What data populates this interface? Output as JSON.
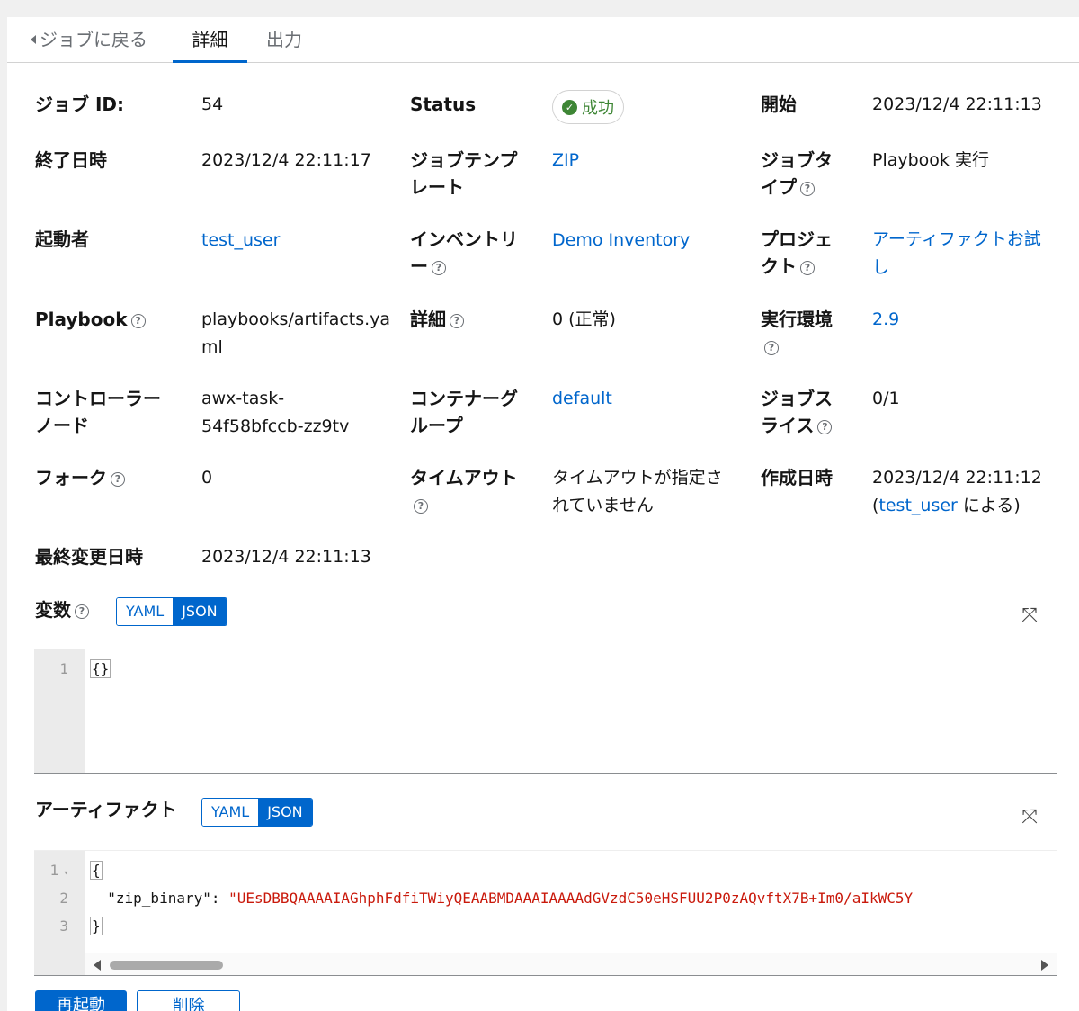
{
  "tabs": {
    "back": "ジョブに戻る",
    "detail": "詳細",
    "output": "出力"
  },
  "details": {
    "job_id": {
      "label": "ジョブ ID:",
      "value": "54"
    },
    "status": {
      "label": "Status",
      "value": "成功"
    },
    "started": {
      "label": "開始",
      "value": "2023/12/4 22:11:13"
    },
    "finished": {
      "label": "終了日時",
      "value": "2023/12/4 22:11:17"
    },
    "job_template": {
      "label_1": "ジョブテンプ",
      "label_2": "レート",
      "value": "ZIP"
    },
    "job_type": {
      "label_1": "ジョブタ",
      "label_2": "イプ",
      "value": "Playbook 実行"
    },
    "launched_by": {
      "label": "起動者",
      "value": "test_user"
    },
    "inventory": {
      "label_1": "インベントリ",
      "label_2": "ー",
      "value": "Demo Inventory"
    },
    "project": {
      "label_1": "プロジェ",
      "label_2": "クト",
      "value_1": "アーティファクトお試",
      "value_2": "し"
    },
    "playbook": {
      "label": "Playbook",
      "value_1": "playbooks/artifacts.ya",
      "value_2": "ml"
    },
    "verbosity": {
      "label": "詳細",
      "value": "0 (正常)"
    },
    "execution_env": {
      "label": "実行環境",
      "value": "2.9"
    },
    "controller_node": {
      "label_1": "コントローラー",
      "label_2": "ノード",
      "value_1": "awx-task-",
      "value_2": "54f58bfccb-zz9tv"
    },
    "container_group": {
      "label_1": "コンテナーグ",
      "label_2": "ループ",
      "value": "default"
    },
    "job_slice": {
      "label_1": "ジョブス",
      "label_2": "ライス",
      "value": "0/1"
    },
    "forks": {
      "label": "フォーク",
      "value": "0"
    },
    "timeout": {
      "label": "タイムアウト",
      "value_1": "タイムアウトが指定さ",
      "value_2": "れていません"
    },
    "created": {
      "label": "作成日時",
      "value": "2023/12/4 22:11:12",
      "by_prefix": "(",
      "by_user": "test_user",
      "by_suffix": " による)"
    },
    "modified": {
      "label": "最終変更日時",
      "value": "2023/12/4 22:11:13"
    }
  },
  "variables": {
    "label": "変数",
    "yaml": "YAML",
    "json": "JSON",
    "selected": "JSON",
    "lines": [
      "1"
    ],
    "code_line_1": "{}"
  },
  "artifacts": {
    "label": "アーティファクト",
    "yaml": "YAML",
    "json": "JSON",
    "selected": "JSON",
    "line_numbers": [
      "1",
      "2",
      "3"
    ],
    "open_brace": "{",
    "key": "\"zip_binary\"",
    "colon": ": ",
    "value": "\"UEsDBBQAAAAIAGhphFdfiTWiyQEAABMDAAAIAAAAdGVzdC50eHSFUU2P0zAQvftX7B+Im0/aIkWC5Y",
    "close_brace": "}"
  },
  "buttons": {
    "relaunch": "再起動",
    "delete": "削除"
  },
  "help_glyph": "?",
  "expand_glyph": "⤧",
  "colors": {
    "accent": "#0066cc",
    "success": "#3e8635"
  }
}
